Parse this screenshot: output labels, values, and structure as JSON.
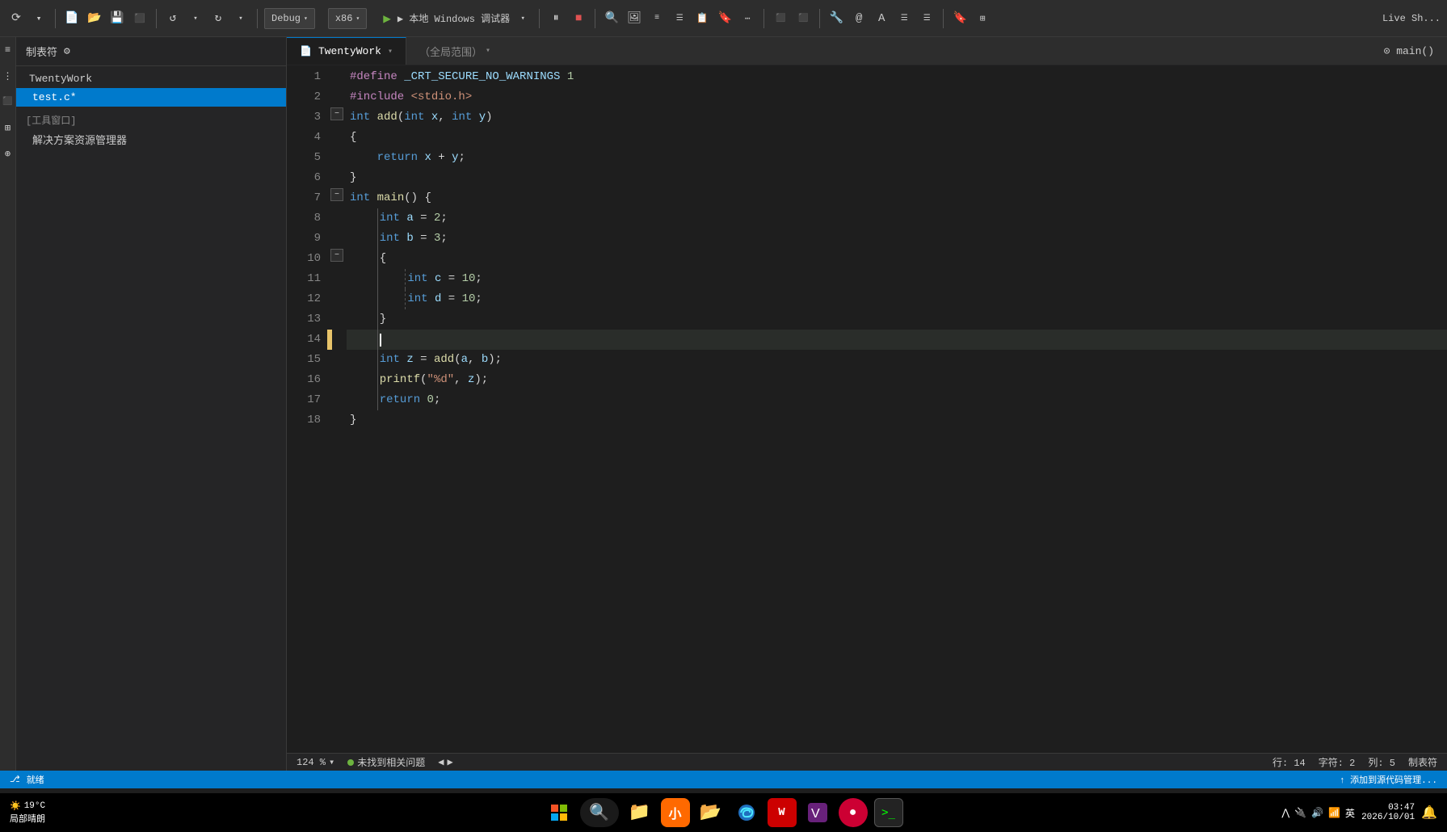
{
  "toolbar": {
    "debug_mode": "Debug",
    "arch": "x86",
    "run_label": "▶ 本地 Windows 调试器",
    "live_share": "Live Sh...",
    "arrow": "▾"
  },
  "tab_bar": {
    "project_name": "TwentyWork",
    "dropdown_arrow": "▾",
    "scope": "（全局范围）",
    "scope_arrow": "▾",
    "function": "⊙ main()"
  },
  "sidebar": {
    "title": "制表符",
    "project": "TwentyWork",
    "active_file": "test.c*",
    "tool_window_label": "[工具窗口]",
    "solution_explorer": "解决方案资源管理器"
  },
  "code": {
    "lines": [
      {
        "num": 1,
        "text": "#define _CRT_SECURE_NO_WARNINGS 1"
      },
      {
        "num": 2,
        "text": "#include <stdio.h>"
      },
      {
        "num": 3,
        "text": "int add(int x, int y)"
      },
      {
        "num": 4,
        "text": "{"
      },
      {
        "num": 5,
        "text": "    return x + y;"
      },
      {
        "num": 6,
        "text": "}"
      },
      {
        "num": 7,
        "text": "int main() {"
      },
      {
        "num": 8,
        "text": "    int a = 2;"
      },
      {
        "num": 9,
        "text": "    int b = 3;"
      },
      {
        "num": 10,
        "text": "    {"
      },
      {
        "num": 11,
        "text": "        int c = 10;"
      },
      {
        "num": 12,
        "text": "        int d = 10;"
      },
      {
        "num": 13,
        "text": "    }"
      },
      {
        "num": 14,
        "text": "    "
      },
      {
        "num": 15,
        "text": "    int z = add(a, b);"
      },
      {
        "num": 16,
        "text": "    printf(\"%d\", z);"
      },
      {
        "num": 17,
        "text": "    return 0;"
      },
      {
        "num": 18,
        "text": "}"
      }
    ]
  },
  "bottom_bar": {
    "zoom": "124 %",
    "zoom_arrow": "▾",
    "no_issues": "未找到相关问题",
    "nav_left": "◀",
    "nav_right": "▶",
    "row": "行: 14",
    "char": "字符: 2",
    "col": "列: 5",
    "mode": "制表符"
  },
  "status_bar": {
    "git": "就绪",
    "add_code": "↑ 添加到源代码管理..."
  },
  "taskbar": {
    "weather": "19°C",
    "weather_sub": "局部晴朗",
    "time": "",
    "lang": "英",
    "start_icon": "⊞"
  }
}
